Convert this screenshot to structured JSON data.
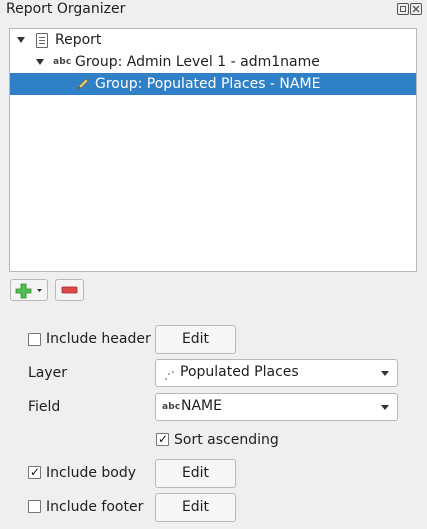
{
  "panel": {
    "title": "Report Organizer"
  },
  "tree": {
    "items": [
      {
        "label": "Report",
        "icon": "report-document-icon"
      },
      {
        "label": "Group: Admin Level 1 - adm1name",
        "icon": "abc-field-icon"
      },
      {
        "label": "Group: Populated Places - NAME",
        "icon": "pencil-icon",
        "selected": true
      }
    ]
  },
  "toolbar": {
    "add_icon": "plus-icon",
    "remove_icon": "minus-icon"
  },
  "form": {
    "include_header": {
      "label": "Include header",
      "checked": false,
      "button": "Edit"
    },
    "layer": {
      "label": "Layer",
      "value": "Populated Places",
      "icon": "point-layer-icon"
    },
    "field": {
      "label": "Field",
      "value": "NAME",
      "icon_text": "abc"
    },
    "sort_ascending": {
      "label": "Sort ascending",
      "checked": true
    },
    "include_body": {
      "label": "Include body",
      "checked": true,
      "button": "Edit"
    },
    "include_footer": {
      "label": "Include footer",
      "checked": false,
      "button": "Edit"
    }
  },
  "colors": {
    "selection": "#3080c8",
    "add_green": "#2e9e2e",
    "remove_red": "#d83232"
  }
}
